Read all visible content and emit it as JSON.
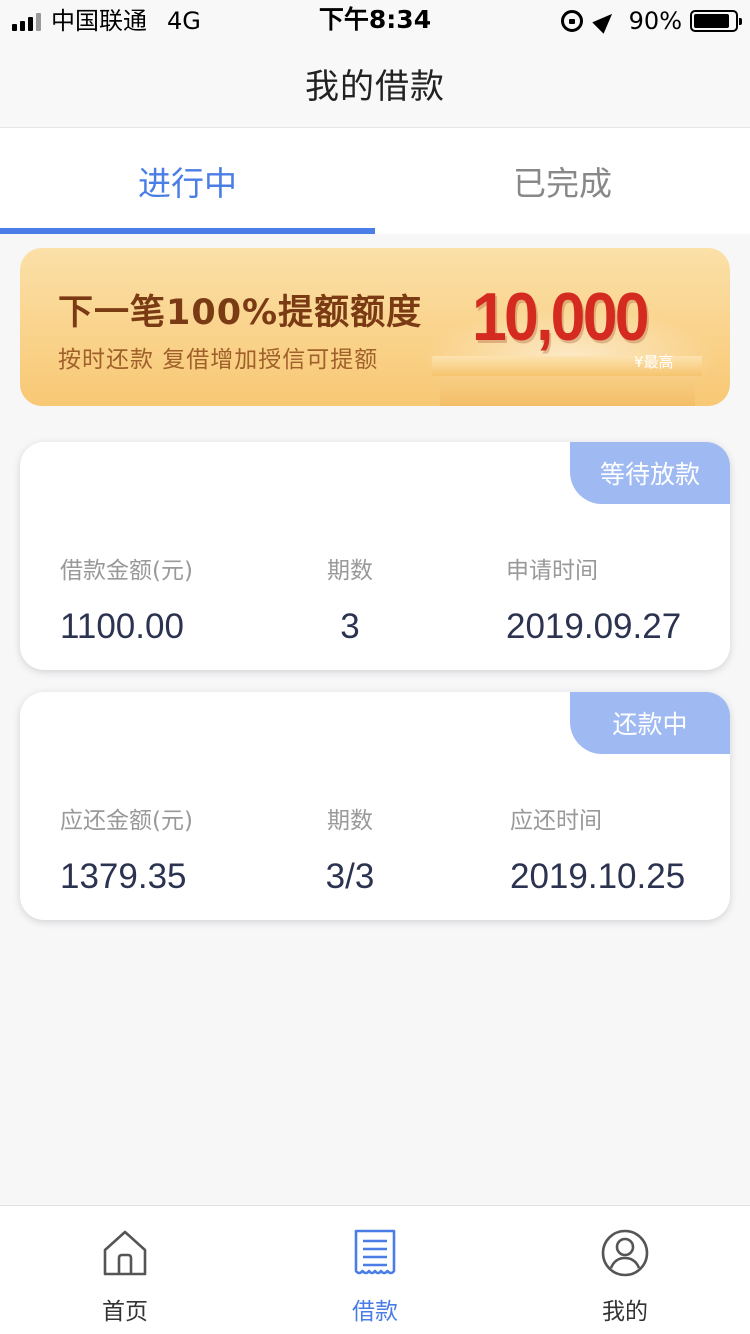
{
  "status_bar": {
    "carrier": "中国联通",
    "network": "4G",
    "time": "下午8:34",
    "battery": "90%"
  },
  "header": {
    "title": "我的借款"
  },
  "tabs": [
    {
      "label": "进行中",
      "active": true
    },
    {
      "label": "已完成",
      "active": false
    }
  ],
  "banner": {
    "title": "下一笔100%提额额度",
    "subtitle": "按时还款  复借增加授信可提额",
    "amount": "10,000",
    "tag": "¥最高"
  },
  "loans": [
    {
      "status": "等待放款",
      "amount_label": "借款金额(元)",
      "amount": "1100.00",
      "periods_label": "期数",
      "periods": "3",
      "date_label": "申请时间",
      "date": "2019.09.27"
    },
    {
      "status": "还款中",
      "amount_label": "应还金额(元)",
      "amount": "1379.35",
      "periods_label": "期数",
      "periods": "3/3",
      "date_label": "应还时间",
      "date": "2019.10.25"
    }
  ],
  "bottom_nav": [
    {
      "label": "首页",
      "icon": "home-icon",
      "active": false
    },
    {
      "label": "借款",
      "icon": "document-icon",
      "active": true
    },
    {
      "label": "我的",
      "icon": "user-icon",
      "active": false
    }
  ],
  "colors": {
    "accent": "#4a7ee6",
    "badge": "#9fbaf2",
    "amount_red": "#d42a1f",
    "value_text": "#2c3350"
  }
}
